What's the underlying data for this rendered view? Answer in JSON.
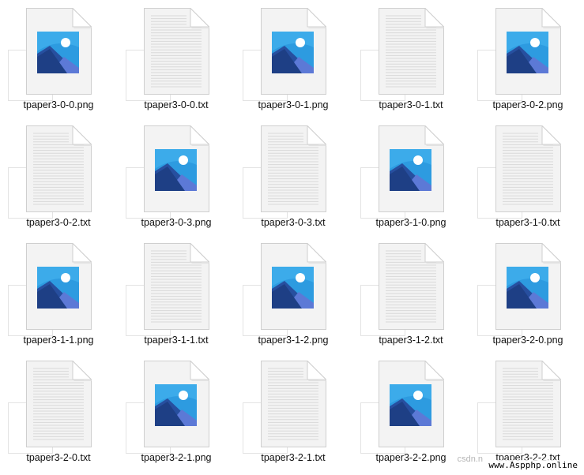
{
  "files": [
    {
      "name": "tpaper3-0-0.png",
      "type": "png"
    },
    {
      "name": "tpaper3-0-0.txt",
      "type": "txt"
    },
    {
      "name": "tpaper3-0-1.png",
      "type": "png"
    },
    {
      "name": "tpaper3-0-1.txt",
      "type": "txt"
    },
    {
      "name": "tpaper3-0-2.png",
      "type": "png"
    },
    {
      "name": "tpaper3-0-2.txt",
      "type": "txt"
    },
    {
      "name": "tpaper3-0-3.png",
      "type": "png"
    },
    {
      "name": "tpaper3-0-3.txt",
      "type": "txt"
    },
    {
      "name": "tpaper3-1-0.png",
      "type": "png"
    },
    {
      "name": "tpaper3-1-0.txt",
      "type": "txt"
    },
    {
      "name": "tpaper3-1-1.png",
      "type": "png"
    },
    {
      "name": "tpaper3-1-1.txt",
      "type": "txt"
    },
    {
      "name": "tpaper3-1-2.png",
      "type": "png"
    },
    {
      "name": "tpaper3-1-2.txt",
      "type": "txt"
    },
    {
      "name": "tpaper3-2-0.png",
      "type": "png"
    },
    {
      "name": "tpaper3-2-0.txt",
      "type": "txt"
    },
    {
      "name": "tpaper3-2-1.png",
      "type": "png"
    },
    {
      "name": "tpaper3-2-1.txt",
      "type": "txt"
    },
    {
      "name": "tpaper3-2-2.png",
      "type": "png"
    },
    {
      "name": "tpaper3-2-2.txt",
      "type": "txt"
    }
  ],
  "icons": {
    "png": "image-file-icon",
    "txt": "text-file-icon"
  },
  "watermark": {
    "faint": "csdn.n",
    "site": "www.Aspphp.online"
  },
  "colors": {
    "page_bg": "#ffffff",
    "image_sky": "#2d9be0",
    "image_mountain": "#1f4e9a",
    "label_text": "#111111"
  }
}
